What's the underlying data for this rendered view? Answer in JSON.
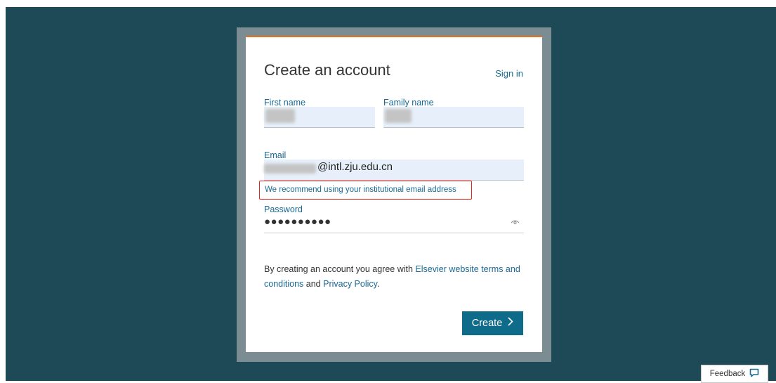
{
  "card": {
    "title": "Create an account",
    "signin_label": "Sign in"
  },
  "fields": {
    "first_name_label": "First name",
    "family_name_label": "Family name",
    "email_label": "Email",
    "email_value_suffix": "@intl.zju.edu.cn",
    "email_recommendation": "We recommend using your institutional email address",
    "password_label": "Password",
    "password_mask": "●●●●●●●●●●"
  },
  "terms": {
    "prefix": "By creating an account you agree with ",
    "terms_link": "Elsevier website terms and conditions",
    "middle": " and ",
    "privacy_link": "Privacy Policy",
    "suffix": "."
  },
  "actions": {
    "create_label": "Create",
    "feedback_label": "Feedback"
  },
  "colors": {
    "accent_orange": "#e9711c",
    "link_blue": "#1a6a94",
    "button_blue": "#0e6b8a",
    "highlight_red": "#e02a20",
    "page_bg": "#1d4a56"
  }
}
